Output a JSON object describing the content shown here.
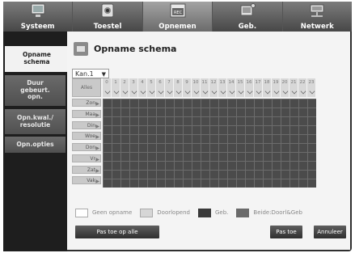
{
  "tabs": [
    {
      "label": "Systeem",
      "icon": "monitor-icon",
      "active": false
    },
    {
      "label": "Toestel",
      "icon": "camera-icon",
      "active": false
    },
    {
      "label": "Opnemen",
      "icon": "rec-icon",
      "active": true
    },
    {
      "label": "Geb.",
      "icon": "event-icon",
      "active": false
    },
    {
      "label": "Netwerk",
      "icon": "network-icon",
      "active": false
    }
  ],
  "sidebar": {
    "items": [
      {
        "label": "Opname schema",
        "active": true
      },
      {
        "label": "Duur gebeurt. opn.",
        "active": false
      },
      {
        "label": "Opn.kwal./ resolutie",
        "active": false
      },
      {
        "label": "Opn.opties",
        "active": false
      }
    ]
  },
  "header": {
    "title": "Opname schema",
    "icon": "rec-icon"
  },
  "channel_select": {
    "value": "Kan.1"
  },
  "schedule": {
    "all_label": "Alles",
    "hours": [
      "0",
      "1",
      "2",
      "3",
      "4",
      "5",
      "6",
      "7",
      "8",
      "9",
      "10",
      "11",
      "12",
      "13",
      "14",
      "15",
      "16",
      "17",
      "18",
      "19",
      "20",
      "21",
      "22",
      "23"
    ],
    "days": [
      "Zon",
      "Maa",
      "Din",
      "Woe",
      "Don",
      "Vr",
      "Zat",
      "Vak"
    ]
  },
  "legend": [
    {
      "label": "Geen opname",
      "color": "#ffffff"
    },
    {
      "label": "Doorlopend",
      "color": "#d6d6d6"
    },
    {
      "label": "Geb.",
      "color": "#3a3a3a"
    },
    {
      "label": "Beide:Doorl&Geb",
      "color": "#6a6a6a"
    }
  ],
  "buttons": {
    "apply_all": "Pas toe op alle",
    "apply": "Pas toe",
    "cancel": "Annuleer"
  }
}
